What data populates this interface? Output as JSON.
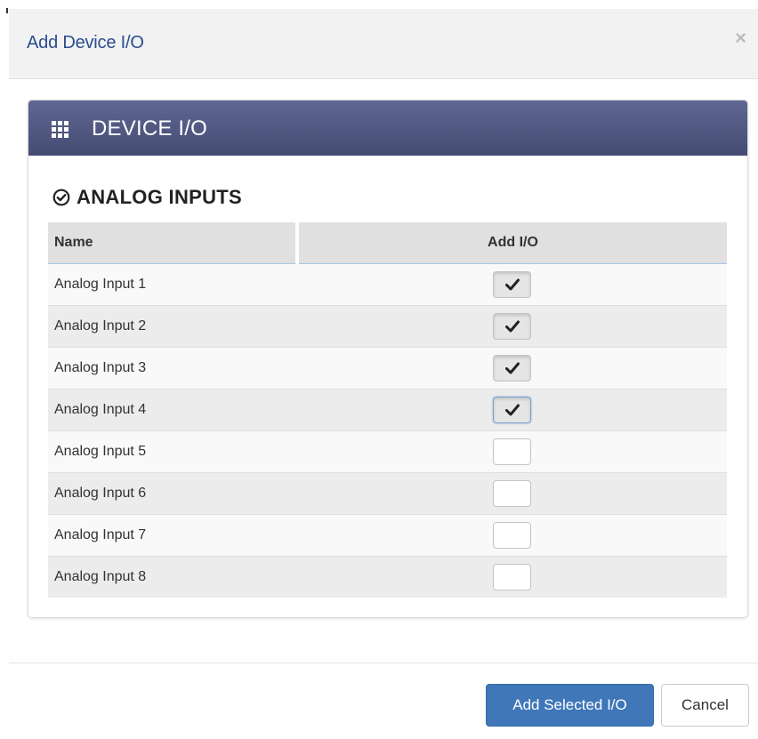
{
  "modal": {
    "title": "Add Device I/O",
    "close_glyph": "×"
  },
  "panel": {
    "title": "DEVICE I/O",
    "icon": "grid-icon"
  },
  "section": {
    "title": "ANALOG INPUTS",
    "icon": "check-circle-icon"
  },
  "table": {
    "columns": [
      "Name",
      "Add I/O"
    ],
    "rows": [
      {
        "name": "Analog Input 1",
        "checked": true
      },
      {
        "name": "Analog Input 2",
        "checked": true
      },
      {
        "name": "Analog Input 3",
        "checked": true
      },
      {
        "name": "Analog Input 4",
        "checked": true
      },
      {
        "name": "Analog Input 5",
        "checked": false
      },
      {
        "name": "Analog Input 6",
        "checked": false
      },
      {
        "name": "Analog Input 7",
        "checked": false
      },
      {
        "name": "Analog Input 8",
        "checked": false
      }
    ]
  },
  "footer": {
    "primary_label": "Add Selected I/O",
    "cancel_label": "Cancel"
  },
  "colors": {
    "title_blue": "#2a4d8f",
    "panel_header": "#4f5680",
    "primary_button": "#3f77b8"
  }
}
